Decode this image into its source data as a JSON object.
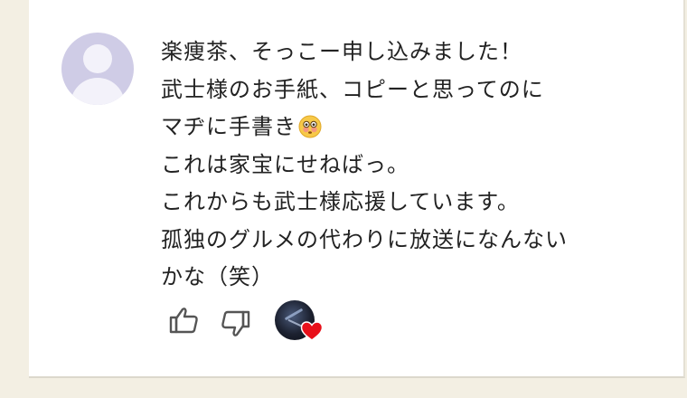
{
  "comment": {
    "lines": [
      "楽痩茶、そっこー申し込みました！",
      "武士様のお手紙、コピーと思ってのに",
      "マヂに手書き",
      "これは家宝にせねばっ。",
      "これからも武士様応援しています。",
      "孤独のグルメの代わりに放送になんない",
      "かな（笑）"
    ],
    "emoji": "flushed-face-emoji"
  },
  "actions": {
    "like_icon": "thumbs-up-icon",
    "dislike_icon": "thumbs-down-icon",
    "creator_heart": "heart-icon",
    "heart_color": "#e8101a"
  },
  "colors": {
    "page_bg": "#f3efe3",
    "avatar_bg": "#cfcce6",
    "text": "#222222"
  }
}
